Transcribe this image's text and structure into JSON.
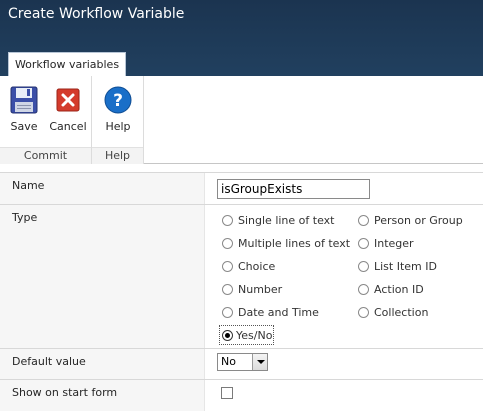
{
  "window": {
    "title": "Create Workflow Variable"
  },
  "ribbon": {
    "tab_label": "Workflow variables",
    "groups": {
      "commit": {
        "label": "Commit",
        "save_label": "Save",
        "cancel_label": "Cancel"
      },
      "help": {
        "label": "Help",
        "help_label": "Help"
      }
    }
  },
  "form": {
    "name": {
      "label": "Name",
      "value": "isGroupExists"
    },
    "type": {
      "label": "Type",
      "options": [
        "Single line of text",
        "Person or Group",
        "Multiple lines of text",
        "Integer",
        "Choice",
        "List Item ID",
        "Number",
        "Action ID",
        "Date and Time",
        "Collection",
        "Yes/No"
      ],
      "selected": "Yes/No"
    },
    "default_value": {
      "label": "Default value",
      "selected": "No"
    },
    "show_on_start_form": {
      "label": "Show on start form",
      "checked": false
    }
  },
  "colors": {
    "titlebar": "#1b3450",
    "help_icon": "#1a6fc8",
    "cancel_icon": "#d43b2c",
    "save_icon": "#3b4fa8"
  },
  "icons": {
    "save": "floppy-disk-icon",
    "cancel": "red-x-icon",
    "help": "help-question-icon"
  }
}
